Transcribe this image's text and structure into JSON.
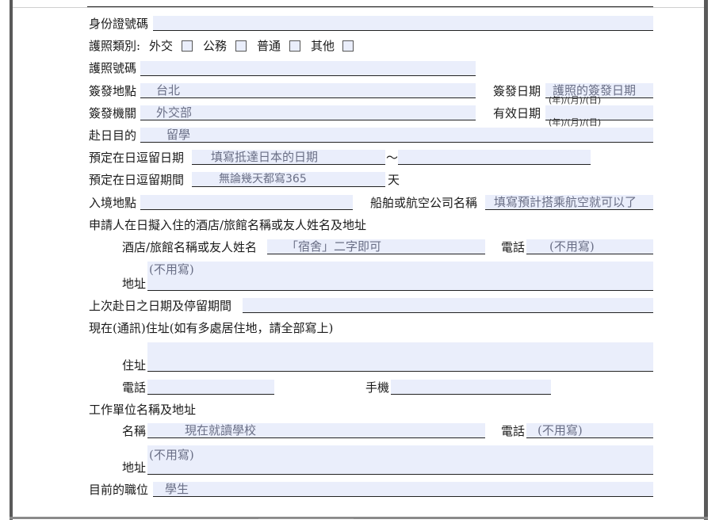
{
  "form": {
    "id_number_label": "身份證號碼",
    "passport_type": {
      "label": "護照類別:",
      "opt_diplomatic": "外交",
      "opt_official": "公務",
      "opt_ordinary": "普通",
      "opt_other": "其他"
    },
    "passport_number_label": "護照號碼",
    "issue_place": {
      "label": "簽發地點",
      "value": "台北"
    },
    "issue_date": {
      "label": "簽發日期",
      "value": "護照的簽發日期",
      "hint": "(年)/(月)/(日)"
    },
    "issue_authority": {
      "label": "簽發機關",
      "value": "外交部"
    },
    "expiry_date": {
      "label": "有效日期",
      "hint": "(年)/(月)/(日)"
    },
    "purpose": {
      "label": "赴日目的",
      "value": "留學"
    },
    "stay_dates": {
      "label": "預定在日逗留日期",
      "value": "填寫抵達日本的日期",
      "tilde": "～"
    },
    "stay_period": {
      "label": "預定在日逗留期間",
      "value": "無論幾天都寫365",
      "unit": "天"
    },
    "entry_port": {
      "label": "入境地點"
    },
    "carrier": {
      "label": "船舶或航空公司名稱",
      "value": "填寫預計搭乘航空就可以了"
    },
    "hotel_section_label": "申請人在日擬入住的酒店/旅館名稱或友人姓名及地址",
    "hotel_name": {
      "label": "酒店/旅館名稱或友人姓名",
      "value": "「宿舍」二字即可"
    },
    "hotel_phone": {
      "label": "電話",
      "value": "(不用寫)"
    },
    "hotel_address": {
      "label": "地址",
      "value": "(不用寫)"
    },
    "last_visit_label": "上次赴日之日期及停留期間",
    "current_address_label": "現在(通訊)住址(如有多處居住地，請全部寫上)",
    "address": {
      "label": "住址"
    },
    "phone": {
      "label": "電話"
    },
    "mobile": {
      "label": "手機"
    },
    "work_section_label": "工作單位名稱及地址",
    "work_name": {
      "label": "名稱",
      "value": "現在就讀學校"
    },
    "work_phone": {
      "label": "電話",
      "value": "(不用寫)"
    },
    "work_address": {
      "label": "地址",
      "value": "(不用寫)"
    },
    "position": {
      "label": "目前的職位",
      "value": "學生"
    }
  }
}
